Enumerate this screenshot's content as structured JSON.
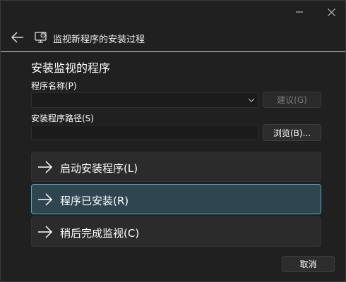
{
  "header": {
    "title": "监视新程序的安装过程",
    "back_icon": "back-arrow-icon",
    "app_icon": "monitor-icon"
  },
  "section": {
    "title": "安装监视的程序"
  },
  "fields": {
    "program_name_label": "程序名称(P)",
    "program_name_value": "",
    "suggest_label": "建议(G)",
    "install_path_label": "安装程序路径(S)",
    "install_path_value": "",
    "browse_label": "浏览(B)..."
  },
  "commands": [
    {
      "label": "启动安装程序(L)",
      "selected": false
    },
    {
      "label": "程序已安装(R)",
      "selected": true
    },
    {
      "label": "稍后完成监视(C)",
      "selected": false
    }
  ],
  "footer": {
    "cancel_label": "取消"
  },
  "colors": {
    "background": "#202020",
    "selected_fill": "#2f4650",
    "selected_border": "#5aa3c2"
  }
}
